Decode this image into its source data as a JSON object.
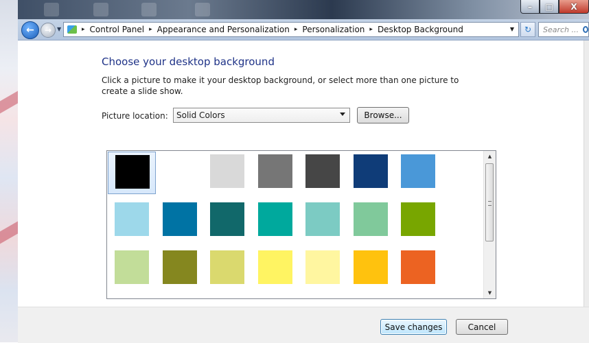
{
  "window": {
    "minimize_label": "–",
    "maximize_label": "□",
    "close_label": "X"
  },
  "address_bar": {
    "breadcrumbs": [
      "Control Panel",
      "Appearance and Personalization",
      "Personalization",
      "Desktop Background"
    ],
    "separator": "▸",
    "search_placeholder": "Search ..."
  },
  "main": {
    "heading": "Choose your desktop background",
    "description": "Click a picture to make it your desktop background, or select more than one picture to create a slide show.",
    "picture_location_label": "Picture location:",
    "picture_location_value": "Solid Colors",
    "browse_label": "Browse..."
  },
  "swatches": [
    {
      "color": "#000000",
      "selected": true
    },
    {
      "color": "#ffffff",
      "selected": false
    },
    {
      "color": "#d9d9d9",
      "selected": false
    },
    {
      "color": "#767676",
      "selected": false
    },
    {
      "color": "#464646",
      "selected": false
    },
    {
      "color": "#0f3c78",
      "selected": false
    },
    {
      "color": "#4a98d8",
      "selected": false
    },
    {
      "color": "#9dd8ea",
      "selected": false
    },
    {
      "color": "#0073a4",
      "selected": false
    },
    {
      "color": "#11686a",
      "selected": false
    },
    {
      "color": "#00a99d",
      "selected": false
    },
    {
      "color": "#7ccbc3",
      "selected": false
    },
    {
      "color": "#80c99b",
      "selected": false
    },
    {
      "color": "#78a600",
      "selected": false
    },
    {
      "color": "#c2dd99",
      "selected": false
    },
    {
      "color": "#85871f",
      "selected": false
    },
    {
      "color": "#dad96e",
      "selected": false
    },
    {
      "color": "#fff462",
      "selected": false
    },
    {
      "color": "#fff6a0",
      "selected": false
    },
    {
      "color": "#ffc20e",
      "selected": false
    },
    {
      "color": "#ec6322",
      "selected": false
    },
    {
      "color": "#f0a45c",
      "selected": false
    },
    {
      "color": "#e07f1e",
      "selected": false
    },
    {
      "color": "#b5541c",
      "selected": false
    },
    {
      "color": "#7b5d42",
      "selected": false
    },
    {
      "color": "#8c6e58",
      "selected": false
    },
    {
      "color": "#c6b9a6",
      "selected": false
    },
    {
      "color": "#a7273a",
      "selected": false
    }
  ],
  "footer": {
    "save_label": "Save changes",
    "cancel_label": "Cancel"
  }
}
